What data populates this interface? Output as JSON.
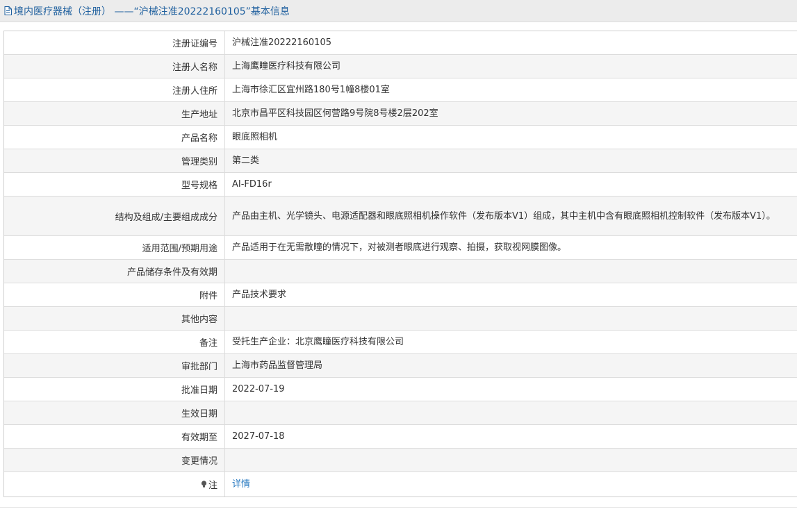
{
  "header": {
    "title": "境内医疗器械（注册） ——“沪械注准20222160105”基本信息",
    "icon": "document-icon",
    "color": "#1e5f9e"
  },
  "table": {
    "rows": [
      {
        "label": "注册证编号",
        "value": "沪械注准20222160105"
      },
      {
        "label": "注册人名称",
        "value": "上海鹰瞳医疗科技有限公司"
      },
      {
        "label": "注册人住所",
        "value": "上海市徐汇区宜州路180号1幢8楼01室"
      },
      {
        "label": "生产地址",
        "value": "北京市昌平区科技园区何营路9号院8号楼2层202室"
      },
      {
        "label": "产品名称",
        "value": "眼底照相机"
      },
      {
        "label": "管理类别",
        "value": "第二类"
      },
      {
        "label": "型号规格",
        "value": "AI-FD16r"
      },
      {
        "label": "结构及组成/主要组成成分",
        "value": "产品由主机、光学镜头、电源适配器和眼底照相机操作软件（发布版本V1）组成，其中主机中含有眼底照相机控制软件（发布版本V1）。"
      },
      {
        "label": "适用范围/预期用途",
        "value": "产品适用于在无需散瞳的情况下，对被测者眼底进行观察、拍摄，获取视网膜图像。"
      },
      {
        "label": "产品储存条件及有效期",
        "value": ""
      },
      {
        "label": "附件",
        "value": "产品技术要求"
      },
      {
        "label": "其他内容",
        "value": ""
      },
      {
        "label": "备注",
        "value": "受托生产企业：北京鹰瞳医疗科技有限公司"
      },
      {
        "label": "审批部门",
        "value": "上海市药品监督管理局"
      },
      {
        "label": "批准日期",
        "value": "2022-07-19"
      },
      {
        "label": "生效日期",
        "value": ""
      },
      {
        "label": "有效期至",
        "value": "2027-07-18"
      },
      {
        "label": "变更情况",
        "value": ""
      }
    ],
    "note": {
      "label": "注",
      "icon": "lightbulb-icon",
      "link_text": "详情",
      "link_color": "#1e73be"
    }
  }
}
